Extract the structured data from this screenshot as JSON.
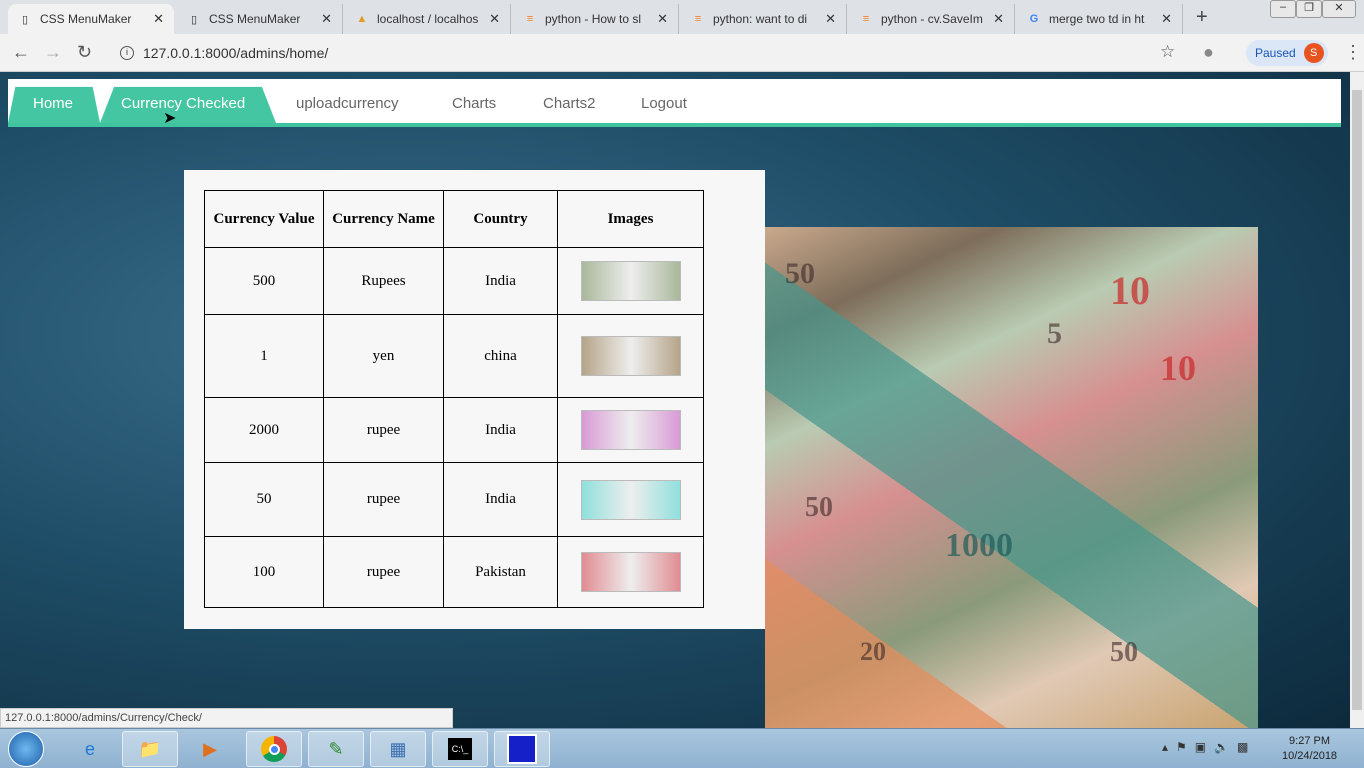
{
  "browser": {
    "tabs": [
      {
        "label": "CSS MenuMaker",
        "icon": "page-icon",
        "active": true
      },
      {
        "label": "CSS MenuMaker",
        "icon": "page-icon"
      },
      {
        "label": "localhost / localhos",
        "icon": "phpmyadmin-icon"
      },
      {
        "label": "python - How to sl",
        "icon": "stackoverflow-icon"
      },
      {
        "label": "python: want to di",
        "icon": "stackoverflow-icon"
      },
      {
        "label": "python - cv.SaveIm",
        "icon": "stackoverflow-icon"
      },
      {
        "label": "merge two td in ht",
        "icon": "google-icon"
      }
    ],
    "url": "127.0.0.1:8000/admins/home/",
    "profile_status": "Paused",
    "profile_initial": "S",
    "status_url": "127.0.0.1:8000/admins/Currency/Check/"
  },
  "nav": {
    "items": [
      "Home",
      "Currency Checked",
      "uploadcurrency",
      "Charts",
      "Charts2",
      "Logout"
    ]
  },
  "table": {
    "headers": [
      "Currency Value",
      "Currency Name",
      "Country",
      "Images"
    ],
    "rows": [
      {
        "value": "500",
        "name": "Rupees",
        "country": "India",
        "note_color": "#a9b79a"
      },
      {
        "value": "1",
        "name": "yen",
        "country": "china",
        "note_color": "#b5a488"
      },
      {
        "value": "2000",
        "name": "rupee",
        "country": "India",
        "note_color": "#d99ad6"
      },
      {
        "value": "50",
        "name": "rupee",
        "country": "India",
        "note_color": "#8fe0dc"
      },
      {
        "value": "100",
        "name": "rupee",
        "country": "Pakistan",
        "note_color": "#e08c92"
      }
    ]
  },
  "money_labels": [
    "50",
    "10",
    "5",
    "1000",
    "50",
    "20",
    "50",
    "10"
  ],
  "taskbar": {
    "time": "9:27 PM",
    "date": "10/24/2018"
  }
}
